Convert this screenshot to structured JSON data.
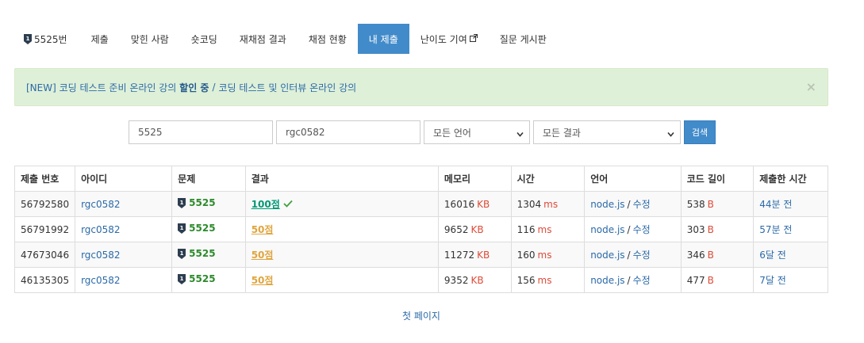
{
  "nav": {
    "problem_label": "5525번",
    "items": [
      "제출",
      "맞힌 사람",
      "숏코딩",
      "재채점 결과",
      "채점 현황",
      "내 제출",
      "난이도 기여",
      "질문 게시판"
    ],
    "active_index": 5
  },
  "alert": {
    "prefix": "[NEW] 코딩 테스트 준비 온라인 강의 ",
    "highlight": "할인 중",
    "separator": "/",
    "second_link": "코딩 테스트 및 인터뷰 온라인 강의",
    "close": "×"
  },
  "search": {
    "problem_value": "5525",
    "user_value": "rgc0582",
    "language_selected": "모든 언어",
    "result_selected": "모든 결과",
    "button_label": "검색"
  },
  "table": {
    "headers": [
      "제출 번호",
      "아이디",
      "문제",
      "결과",
      "메모리",
      "시간",
      "언어",
      "코드 길이",
      "제출한 시간"
    ],
    "rows": [
      {
        "id": "56792580",
        "user": "rgc0582",
        "problem": "5525",
        "result": "100점",
        "memory": "16016",
        "memory_unit": "KB",
        "time": "1304",
        "time_unit": "ms",
        "language": "node.js",
        "edit": "수정",
        "length": "538",
        "length_unit": "B",
        "submitted": "44분 전"
      },
      {
        "id": "56791992",
        "user": "rgc0582",
        "problem": "5525",
        "result": "50점",
        "memory": "9652",
        "memory_unit": "KB",
        "time": "116",
        "time_unit": "ms",
        "language": "node.js",
        "edit": "수정",
        "length": "303",
        "length_unit": "B",
        "submitted": "57분 전"
      },
      {
        "id": "47673046",
        "user": "rgc0582",
        "problem": "5525",
        "result": "50점",
        "memory": "11272",
        "memory_unit": "KB",
        "time": "160",
        "time_unit": "ms",
        "language": "node.js",
        "edit": "수정",
        "length": "346",
        "length_unit": "B",
        "submitted": "6달 전"
      },
      {
        "id": "46135305",
        "user": "rgc0582",
        "problem": "5525",
        "result": "50점",
        "memory": "9352",
        "memory_unit": "KB",
        "time": "156",
        "time_unit": "ms",
        "language": "node.js",
        "edit": "수정",
        "length": "477",
        "length_unit": "B",
        "submitted": "7달 전"
      }
    ]
  },
  "pager": {
    "first_page": "첫 페이지"
  },
  "colors": {
    "accent": "#428bca",
    "alert_bg": "#dff0d8",
    "result_full": "#009874",
    "result_partial": "#e0a53e",
    "unit": "#dd4b39"
  },
  "icons": {
    "tier": "tier-badge-icon",
    "external": "external-link-icon",
    "check": "check-icon",
    "close": "close-icon"
  }
}
